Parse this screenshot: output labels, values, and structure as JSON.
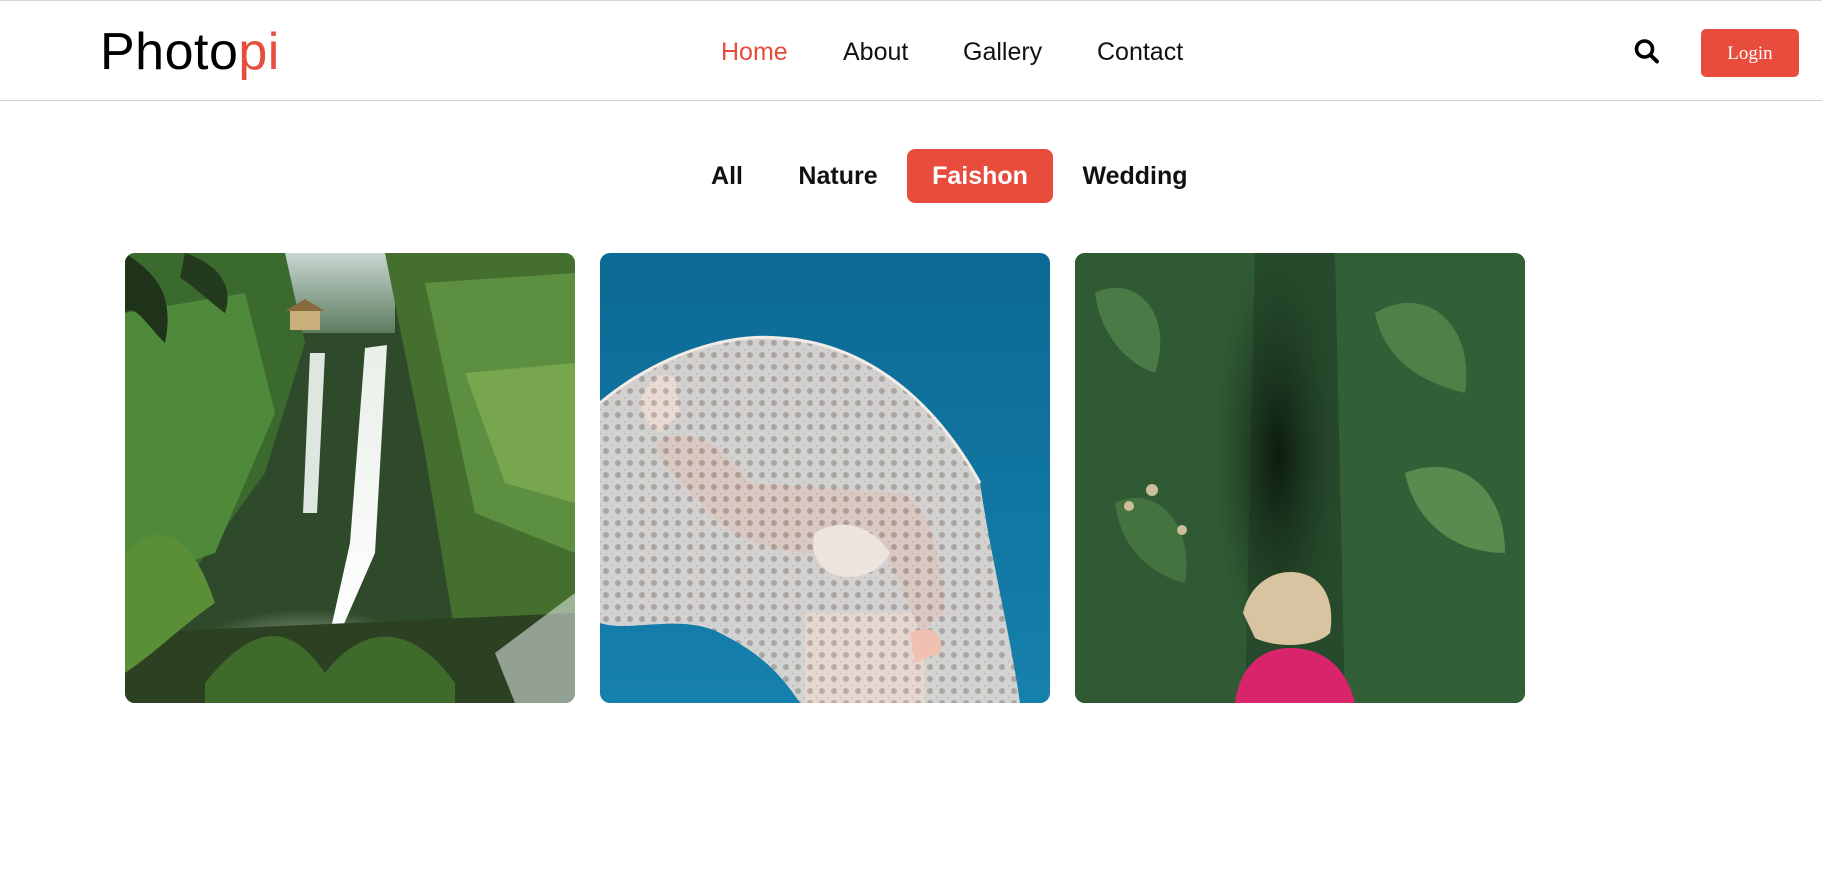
{
  "brand": {
    "prefix": "Photo",
    "suffix": "pi",
    "accent_color": "#e74c3c"
  },
  "nav": {
    "items": [
      {
        "label": "Home",
        "active": true
      },
      {
        "label": "About",
        "active": false
      },
      {
        "label": "Gallery",
        "active": false
      },
      {
        "label": "Contact",
        "active": false
      }
    ]
  },
  "header_actions": {
    "search_icon": "search-icon",
    "login_label": "Login"
  },
  "filters": {
    "items": [
      {
        "label": "All",
        "active": false
      },
      {
        "label": "Nature",
        "active": false
      },
      {
        "label": "Faishon",
        "active": true
      },
      {
        "label": "Wedding",
        "active": false
      }
    ]
  },
  "gallery": {
    "images": [
      {
        "subject": "waterfall-photo"
      },
      {
        "subject": "lace-veil-fashion-photo"
      },
      {
        "subject": "child-in-hedge-photo"
      }
    ]
  }
}
